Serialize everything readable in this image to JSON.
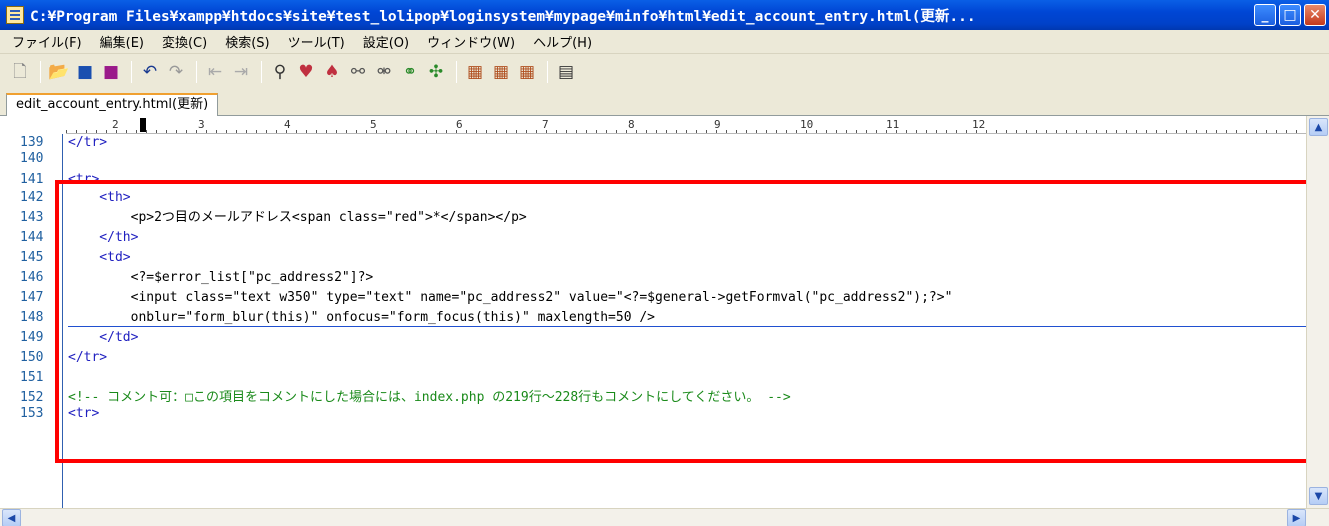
{
  "window": {
    "title": "C:¥Program Files¥xampp¥htdocs¥site¥test_lolipop¥loginsystem¥mypage¥minfo¥html¥edit_account_entry.html(更新..."
  },
  "menu": [
    "ファイル(F)",
    "編集(E)",
    "変換(C)",
    "検索(S)",
    "ツール(T)",
    "設定(O)",
    "ウィンドウ(W)",
    "ヘルプ(H)"
  ],
  "toolbar_icons": [
    "new-file-icon",
    "open-file-icon",
    "save-icon",
    "save-all-icon",
    "undo-icon",
    "redo-icon",
    "back-icon",
    "forward-icon",
    "find-icon",
    "find-next-icon",
    "find-prev-icon",
    "replace-icon",
    "find-in-files-icon",
    "grep-icon",
    "tag-jump-icon",
    "macro-icon",
    "macro-run-icon",
    "macro-edit-icon",
    "properties-icon"
  ],
  "tab": {
    "label": "edit_account_entry.html(更新)"
  },
  "ruler": [
    "2",
    "3",
    "4",
    "5",
    "6",
    "7",
    "8",
    "9",
    "10",
    "11",
    "12"
  ],
  "line_numbers": [
    "139",
    "140",
    "141",
    "142",
    "143",
    "144",
    "145",
    "146",
    "147",
    "148",
    "149",
    "150",
    "151",
    "152",
    "153"
  ],
  "code_lines": [
    "</tr>",
    "",
    "<tr>",
    "    <th>",
    "        <p>2つ目のメールアドレス<span class=\"red\">*</span></p>",
    "    </th>",
    "    <td>",
    "        <?=$error_list[\"pc_address2\"]?>",
    "        <input class=\"text w350\" type=\"text\" name=\"pc_address2\" value=\"<?=$general->getFormval(\"pc_address2\");?>\"",
    "        onblur=\"form_blur(this)\" onfocus=\"form_focus(this)\" maxlength=50 />",
    "    </td>",
    "</tr>",
    "",
    "<!-- コメント可：□この項目をコメントにした場合には、index.php の219行～228行もコメントにしてください。 -->",
    "<tr>"
  ],
  "colors": {
    "highlight": "#ff0000",
    "comment": "#1a8a1a",
    "tag": "#2020c0"
  }
}
